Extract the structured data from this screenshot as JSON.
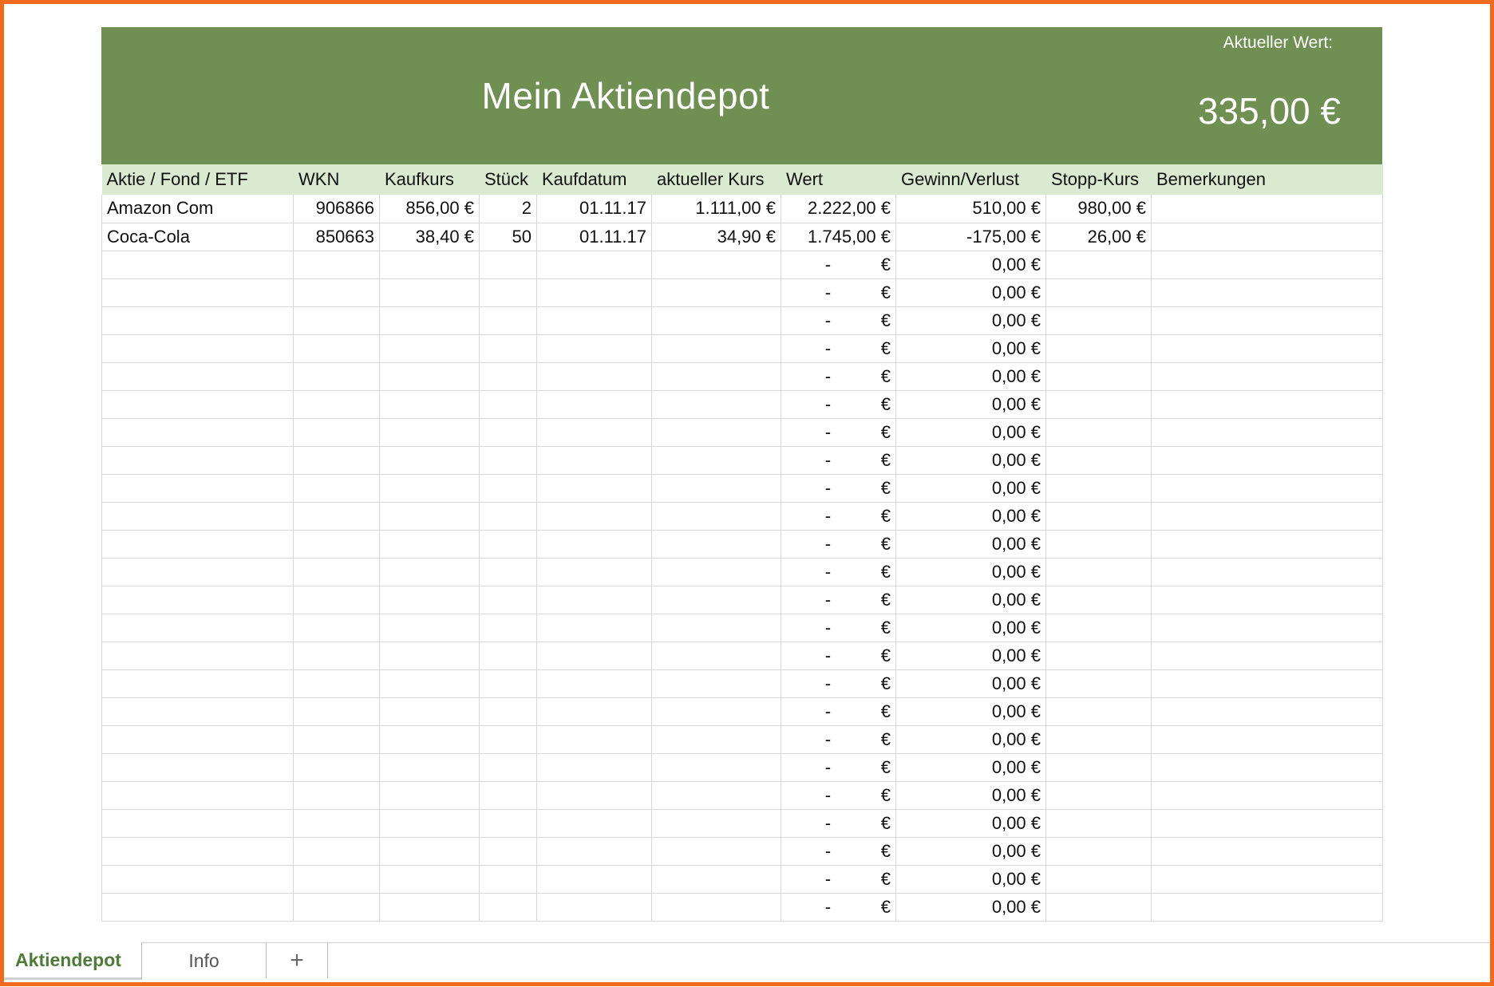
{
  "banner": {
    "title": "Mein Aktiendepot",
    "value_label": "Aktueller Wert:",
    "value": "335,00 €"
  },
  "columns": [
    "Aktie / Fond / ETF",
    "WKN",
    "Kaufkurs",
    "Stück",
    "Kaufdatum",
    "aktueller Kurs",
    "Wert",
    "Gewinn/Verlust",
    "Stopp-Kurs",
    "Bemerkungen"
  ],
  "rows": [
    {
      "name": "Amazon Com",
      "wkn": "906866",
      "kaufkurs": "856,00 €",
      "stueck": "2",
      "kaufdatum": "01.11.17",
      "kurs": "1.111,00 €",
      "wert": "2.222,00 €",
      "gewinn": "510,00 €",
      "stopp": "980,00 €",
      "bemerkung": ""
    },
    {
      "name": "Coca-Cola",
      "wkn": "850663",
      "kaufkurs": "38,40 €",
      "stueck": "50",
      "kaufdatum": "01.11.17",
      "kurs": "34,90 €",
      "wert": "1.745,00 €",
      "gewinn": "-175,00 €",
      "stopp": "26,00 €",
      "bemerkung": ""
    }
  ],
  "empty_row": {
    "wert_dash": "-",
    "wert_currency": "€",
    "gewinn": "0,00 €"
  },
  "empty_row_count": 24,
  "colors": {
    "banner": "#6f8f53",
    "header": "#d9ead0",
    "negative": "#c0504d",
    "frame": "#f06a1e"
  },
  "tabs": [
    {
      "label": "Aktiendepot",
      "active": true
    },
    {
      "label": "Info",
      "active": false
    },
    {
      "label": "+",
      "icon": "plus-icon"
    }
  ]
}
